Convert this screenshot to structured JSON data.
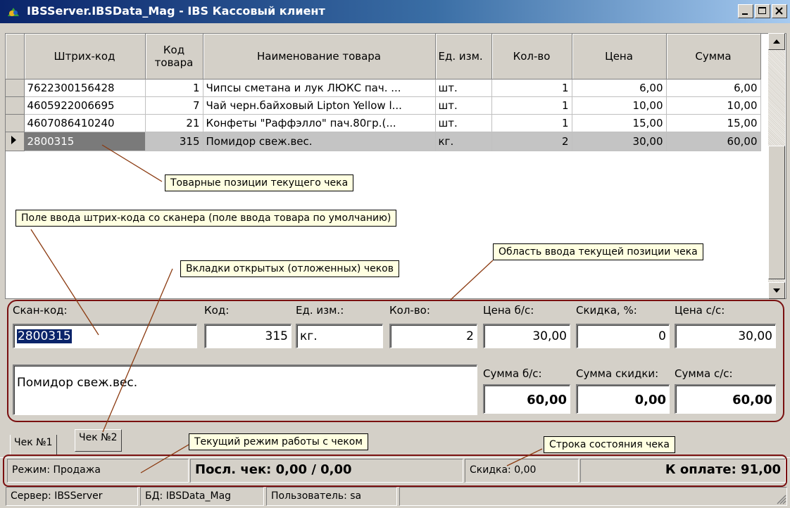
{
  "window": {
    "title": "IBSServer.IBSData_Mag - IBS Кассовый клиент"
  },
  "grid": {
    "headers": {
      "barcode": "Штрих-код",
      "code": "Код товара",
      "name": "Наименование товара",
      "unit": "Ед. изм.",
      "qty": "Кол-во",
      "price": "Цена",
      "sum": "Сумма"
    },
    "rows": [
      {
        "barcode": "7622300156428",
        "code": "1",
        "name": "Чипсы сметана и лук ЛЮКС пач. ...",
        "unit": "шт.",
        "qty": "1",
        "price": "6,00",
        "sum": "6,00"
      },
      {
        "barcode": "4605922006695",
        "code": "7",
        "name": "Чай черн.байховый Lipton Yellow l...",
        "unit": "шт.",
        "qty": "1",
        "price": "10,00",
        "sum": "10,00"
      },
      {
        "barcode": "4607086410240",
        "code": "21",
        "name": "Конфеты \"Раффэлло\" пач.80гр.(...",
        "unit": "шт.",
        "qty": "1",
        "price": "15,00",
        "sum": "15,00"
      },
      {
        "barcode": "2800315",
        "code": "315",
        "name": "Помидор свеж.вес.",
        "unit": "кг.",
        "qty": "2",
        "price": "30,00",
        "sum": "60,00"
      }
    ]
  },
  "entry": {
    "labels": {
      "scan": "Скан-код:",
      "code": "Код:",
      "unit": "Ед. изм.:",
      "qty": "Кол-во:",
      "price_bs": "Цена б/с:",
      "discount_pct": "Скидка, %:",
      "price_ss": "Цена с/с:",
      "sum_bs": "Сумма б/с:",
      "sum_discount": "Сумма скидки:",
      "sum_ss": "Сумма с/с:"
    },
    "values": {
      "scan": "2800315",
      "code": "315",
      "unit": "кг.",
      "qty": "2",
      "price_bs": "30,00",
      "discount_pct": "0",
      "price_ss": "30,00",
      "name": "Помидор свеж.вес.",
      "sum_bs": "60,00",
      "sum_discount": "0,00",
      "sum_ss": "60,00"
    }
  },
  "tabs": [
    "Чек №1",
    "Чек №2"
  ],
  "status": {
    "mode": "Режим: Продажа",
    "last_check": "Посл. чек: 0,00 / 0,00",
    "discount": "Скидка: 0,00",
    "to_pay": "К оплате: 91,00"
  },
  "statusbar": {
    "server": "Сервер: IBSServer",
    "db": "БД: IBSData_Mag",
    "user": "Пользователь: sa"
  },
  "callouts": {
    "positions": "Товарные позиции текущего чека",
    "scan_field": "Поле ввода штрих-кода со сканера (поле ввода товара по умолчанию)",
    "entry_area": "Область ввода текущей позиции чека",
    "tabs": "Вкладки открытых (отложенных) чеков",
    "mode": "Текущий режим работы с чеком",
    "status_line": "Строка состояния чека"
  }
}
